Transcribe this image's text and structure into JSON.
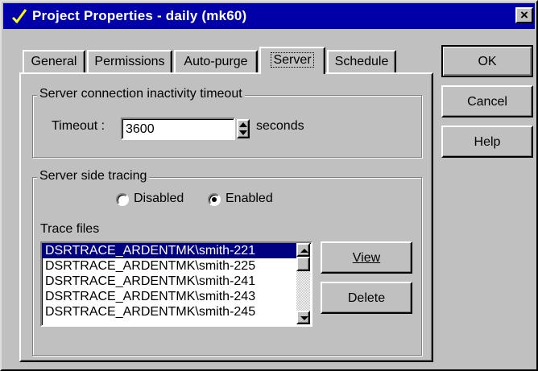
{
  "window": {
    "title": "Project Properties - daily (mk60)",
    "close_glyph": "×",
    "icon": "project-check-icon"
  },
  "tabs": [
    {
      "label": "General",
      "active": false
    },
    {
      "label": "Permissions",
      "active": false
    },
    {
      "label": "Auto-purge",
      "active": false
    },
    {
      "label": "Server",
      "active": true
    },
    {
      "label": "Schedule",
      "active": false
    }
  ],
  "buttons": {
    "ok": "OK",
    "cancel": "Cancel",
    "help": "Help",
    "view": "View",
    "delete": "Delete"
  },
  "timeout_group": {
    "label": "Server connection inactivity timeout",
    "field_label": "Timeout :",
    "value": "3600",
    "unit": "seconds"
  },
  "tracing_group": {
    "label": "Server side tracing",
    "radio_disabled": "Disabled",
    "radio_enabled": "Enabled",
    "selected": "Enabled",
    "trace_files_label": "Trace files",
    "files": [
      "DSRTRACE_ARDENTMK\\smith-221",
      "DSRTRACE_ARDENTMK\\smith-225",
      "DSRTRACE_ARDENTMK\\smith-241",
      "DSRTRACE_ARDENTMK\\smith-243",
      "DSRTRACE_ARDENTMK\\smith-245"
    ],
    "selected_index": 0
  },
  "colors": {
    "titlebar": "#0000a8",
    "face": "#c0c0c0",
    "selection": "#000080"
  }
}
